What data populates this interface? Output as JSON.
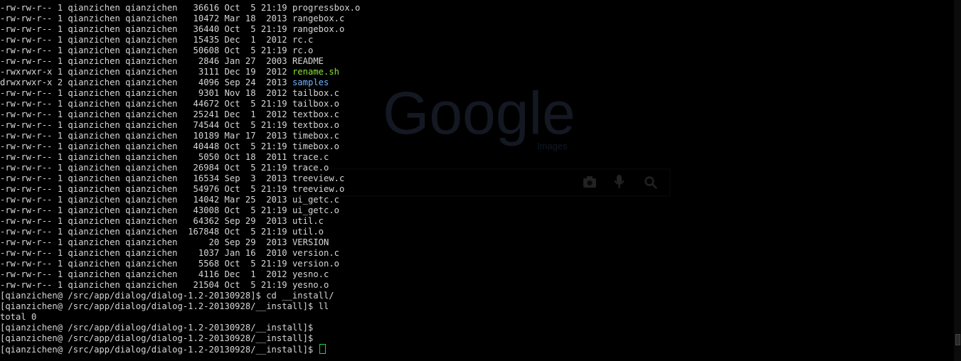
{
  "wallpaper": {
    "logo_text": "Google",
    "logo_sub": "Images",
    "icons": [
      "camera-icon",
      "microphone-icon",
      "search-icon"
    ]
  },
  "listing": [
    {
      "perms": "-rw-rw-r--",
      "links": "1",
      "owner": "qianzichen",
      "group": "qianzichen",
      "size": "36616",
      "date": "Oct  5 21:19",
      "name": "progressbox.o",
      "kind": "file"
    },
    {
      "perms": "-rw-rw-r--",
      "links": "1",
      "owner": "qianzichen",
      "group": "qianzichen",
      "size": "10472",
      "date": "Mar 18  2013",
      "name": "rangebox.c",
      "kind": "file"
    },
    {
      "perms": "-rw-rw-r--",
      "links": "1",
      "owner": "qianzichen",
      "group": "qianzichen",
      "size": "36440",
      "date": "Oct  5 21:19",
      "name": "rangebox.o",
      "kind": "file"
    },
    {
      "perms": "-rw-rw-r--",
      "links": "1",
      "owner": "qianzichen",
      "group": "qianzichen",
      "size": "15435",
      "date": "Dec  1  2012",
      "name": "rc.c",
      "kind": "file"
    },
    {
      "perms": "-rw-rw-r--",
      "links": "1",
      "owner": "qianzichen",
      "group": "qianzichen",
      "size": "50608",
      "date": "Oct  5 21:19",
      "name": "rc.o",
      "kind": "file"
    },
    {
      "perms": "-rw-rw-r--",
      "links": "1",
      "owner": "qianzichen",
      "group": "qianzichen",
      "size": "2846",
      "date": "Jan 27  2003",
      "name": "README",
      "kind": "file"
    },
    {
      "perms": "-rwxrwxr-x",
      "links": "1",
      "owner": "qianzichen",
      "group": "qianzichen",
      "size": "3111",
      "date": "Dec 19  2012",
      "name": "rename.sh",
      "kind": "exec"
    },
    {
      "perms": "drwxrwxr-x",
      "links": "2",
      "owner": "qianzichen",
      "group": "qianzichen",
      "size": "4096",
      "date": "Sep 24  2013",
      "name": "samples",
      "kind": "dir"
    },
    {
      "perms": "-rw-rw-r--",
      "links": "1",
      "owner": "qianzichen",
      "group": "qianzichen",
      "size": "9301",
      "date": "Nov 18  2012",
      "name": "tailbox.c",
      "kind": "file"
    },
    {
      "perms": "-rw-rw-r--",
      "links": "1",
      "owner": "qianzichen",
      "group": "qianzichen",
      "size": "44672",
      "date": "Oct  5 21:19",
      "name": "tailbox.o",
      "kind": "file"
    },
    {
      "perms": "-rw-rw-r--",
      "links": "1",
      "owner": "qianzichen",
      "group": "qianzichen",
      "size": "25241",
      "date": "Dec  1  2012",
      "name": "textbox.c",
      "kind": "file"
    },
    {
      "perms": "-rw-rw-r--",
      "links": "1",
      "owner": "qianzichen",
      "group": "qianzichen",
      "size": "74544",
      "date": "Oct  5 21:19",
      "name": "textbox.o",
      "kind": "file"
    },
    {
      "perms": "-rw-rw-r--",
      "links": "1",
      "owner": "qianzichen",
      "group": "qianzichen",
      "size": "10189",
      "date": "Mar 17  2013",
      "name": "timebox.c",
      "kind": "file"
    },
    {
      "perms": "-rw-rw-r--",
      "links": "1",
      "owner": "qianzichen",
      "group": "qianzichen",
      "size": "40448",
      "date": "Oct  5 21:19",
      "name": "timebox.o",
      "kind": "file"
    },
    {
      "perms": "-rw-rw-r--",
      "links": "1",
      "owner": "qianzichen",
      "group": "qianzichen",
      "size": "5050",
      "date": "Oct 18  2011",
      "name": "trace.c",
      "kind": "file"
    },
    {
      "perms": "-rw-rw-r--",
      "links": "1",
      "owner": "qianzichen",
      "group": "qianzichen",
      "size": "26984",
      "date": "Oct  5 21:19",
      "name": "trace.o",
      "kind": "file"
    },
    {
      "perms": "-rw-rw-r--",
      "links": "1",
      "owner": "qianzichen",
      "group": "qianzichen",
      "size": "16534",
      "date": "Sep  3  2013",
      "name": "treeview.c",
      "kind": "file"
    },
    {
      "perms": "-rw-rw-r--",
      "links": "1",
      "owner": "qianzichen",
      "group": "qianzichen",
      "size": "54976",
      "date": "Oct  5 21:19",
      "name": "treeview.o",
      "kind": "file"
    },
    {
      "perms": "-rw-rw-r--",
      "links": "1",
      "owner": "qianzichen",
      "group": "qianzichen",
      "size": "14042",
      "date": "Mar 25  2013",
      "name": "ui_getc.c",
      "kind": "file"
    },
    {
      "perms": "-rw-rw-r--",
      "links": "1",
      "owner": "qianzichen",
      "group": "qianzichen",
      "size": "43008",
      "date": "Oct  5 21:19",
      "name": "ui_getc.o",
      "kind": "file"
    },
    {
      "perms": "-rw-rw-r--",
      "links": "1",
      "owner": "qianzichen",
      "group": "qianzichen",
      "size": "64362",
      "date": "Sep 29  2013",
      "name": "util.c",
      "kind": "file"
    },
    {
      "perms": "-rw-rw-r--",
      "links": "1",
      "owner": "qianzichen",
      "group": "qianzichen",
      "size": "167848",
      "date": "Oct  5 21:19",
      "name": "util.o",
      "kind": "file"
    },
    {
      "perms": "-rw-rw-r--",
      "links": "1",
      "owner": "qianzichen",
      "group": "qianzichen",
      "size": "20",
      "date": "Sep 29  2013",
      "name": "VERSION",
      "kind": "file"
    },
    {
      "perms": "-rw-rw-r--",
      "links": "1",
      "owner": "qianzichen",
      "group": "qianzichen",
      "size": "1037",
      "date": "Jan 16  2010",
      "name": "version.c",
      "kind": "file"
    },
    {
      "perms": "-rw-rw-r--",
      "links": "1",
      "owner": "qianzichen",
      "group": "qianzichen",
      "size": "5568",
      "date": "Oct  5 21:19",
      "name": "version.o",
      "kind": "file"
    },
    {
      "perms": "-rw-rw-r--",
      "links": "1",
      "owner": "qianzichen",
      "group": "qianzichen",
      "size": "4116",
      "date": "Dec  1  2012",
      "name": "yesno.c",
      "kind": "file"
    },
    {
      "perms": "-rw-rw-r--",
      "links": "1",
      "owner": "qianzichen",
      "group": "qianzichen",
      "size": "21504",
      "date": "Oct  5 21:19",
      "name": "yesno.o",
      "kind": "file"
    }
  ],
  "session": [
    "[qianzichen@ /src/app/dialog/dialog-1.2-20130928]$ cd __install/",
    "[qianzichen@ /src/app/dialog/dialog-1.2-20130928/__install]$ ll",
    "total 0",
    "[qianzichen@ /src/app/dialog/dialog-1.2-20130928/__install]$",
    "[qianzichen@ /src/app/dialog/dialog-1.2-20130928/__install]$"
  ],
  "prompt_line": "[qianzichen@ /src/app/dialog/dialog-1.2-20130928/__install]$ ",
  "colors": {
    "background": "#000000",
    "text": "#d6d6d6",
    "executable": "#8ae234",
    "directory": "#6fb3ff",
    "cursor": "#23d14a"
  }
}
